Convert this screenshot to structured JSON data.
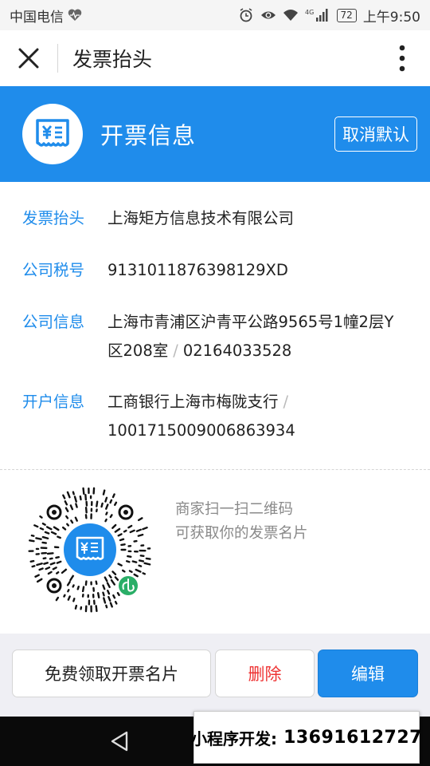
{
  "status_bar": {
    "carrier": "中国电信",
    "battery": "72",
    "time": "上午9:50",
    "network": "4G"
  },
  "nav": {
    "title": "发票抬头"
  },
  "header": {
    "title": "开票信息",
    "cancel_default_label": "取消默认"
  },
  "info": [
    {
      "label": "发票抬头",
      "lines": [
        "上海矩方信息技术有限公司"
      ]
    },
    {
      "label": "公司税号",
      "lines": [
        "9131011876398129XD"
      ]
    },
    {
      "label": "公司信息",
      "line1": "上海市青浦区沪青平公路9565号1幢2层Y",
      "line2a": "区208室",
      "line2b": "02164033528"
    },
    {
      "label": "开户信息",
      "line1a": "工商银行上海市梅陇支行",
      "line2": "1001715009006863934"
    }
  ],
  "qr": {
    "hint_line1": "商家扫一扫二维码",
    "hint_line2": "可获取你的发票名片"
  },
  "buttons": {
    "free_card": "免费领取开票名片",
    "delete": "删除",
    "edit": "编辑"
  },
  "watermark": {
    "label": "小程序开发:",
    "phone": "13691612727"
  },
  "colors": {
    "primary": "#1f8ceb",
    "danger": "#e33333",
    "mini_program_green": "#2aae67"
  }
}
